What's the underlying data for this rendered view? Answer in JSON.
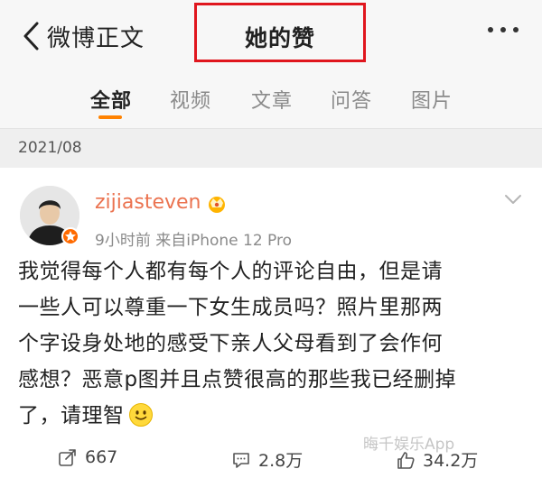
{
  "header": {
    "back_label": "微博正文",
    "title": "她的赞"
  },
  "tabs": [
    {
      "label": "全部",
      "active": true
    },
    {
      "label": "视频",
      "active": false
    },
    {
      "label": "文章",
      "active": false
    },
    {
      "label": "问答",
      "active": false
    },
    {
      "label": "图片",
      "active": false
    }
  ],
  "date_header": "2021/08",
  "post": {
    "username": "zijiasteven",
    "meta": "9小时前  来自iPhone 12 Pro",
    "lines": [
      "我觉得每个人都有每个人的评论自由，但是请",
      "一些人可以尊重一下女生成员吗？照片里那两",
      "个字设身处地的感受下亲人父母看到了会作何",
      "感想？恶意p图并且点赞很高的那些我已经删掉",
      "了，请理智"
    ],
    "reposts": "667",
    "comments": "2.8万",
    "likes": "34.2万",
    "watermark": "晦千娱乐App"
  },
  "colors": {
    "accent": "#ff8200",
    "username": "#eb7350",
    "highlight_box": "#e0161e"
  }
}
